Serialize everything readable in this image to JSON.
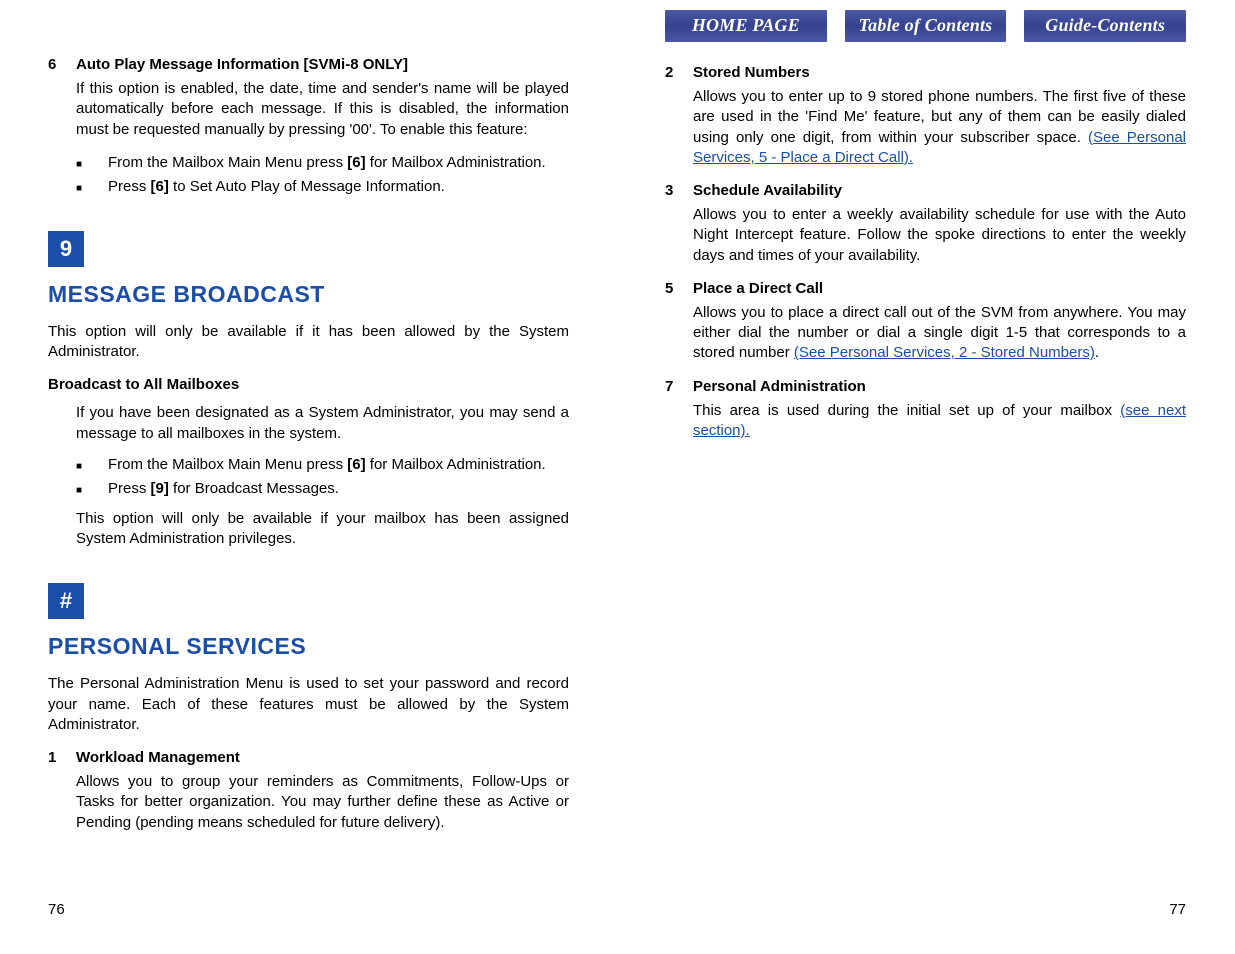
{
  "nav": {
    "home": "HOME PAGE",
    "toc": "Table of Contents",
    "guide": "Guide-Contents"
  },
  "left": {
    "item6": {
      "num": "6",
      "title": "Auto Play Message Information [SVMi-8 ONLY]",
      "body": "If this option is enabled, the date, time and sender's name will be played automatically before each message. If this is disabled, the information must be requested manually by pressing '00'. To enable this feature:",
      "b1_a": "From the Mailbox Main Menu press ",
      "b1_key": "[6]",
      "b1_b": " for Mailbox Administration.",
      "b2_a": "Press ",
      "b2_key": "[6]",
      "b2_b": " to Set Auto Play of Message Information."
    },
    "key9": "9",
    "sec9_title": "MESSAGE BROADCAST",
    "sec9_body": "This option will only be available if it has been allowed by the System Administrator.",
    "broadcast_title": "Broadcast to All Mailboxes",
    "broadcast_body": "If you have been designated as a System Administrator, you may send a message to all mailboxes in the system.",
    "broadcast_b1_a": "From the Mailbox Main Menu press ",
    "broadcast_b1_key": "[6]",
    "broadcast_b1_b": " for Mailbox Administration.",
    "broadcast_b2_a": "Press ",
    "broadcast_b2_key": "[9]",
    "broadcast_b2_b": " for Broadcast Messages.",
    "broadcast_after": "This option will only be available if your mailbox has been assigned System Administration privileges.",
    "keyhash": "#",
    "sec_ps_title": "PERSONAL SERVICES",
    "sec_ps_body": "The Personal Administration Menu is used to set your password and record your name. Each of these features must be allowed by the System Administrator.",
    "item1": {
      "num": "1",
      "title": "Workload Management",
      "body": "Allows you to group your reminders as Commitments, Follow-Ups or Tasks for better organization. You may further define these as Active or Pending (pending means scheduled for future delivery)."
    },
    "pageno": "76"
  },
  "right": {
    "item2": {
      "num": "2",
      "title": "Stored Numbers",
      "body_a": "Allows you to enter up to 9 stored phone numbers. The first five of these are used in the 'Find Me' feature, but any of them can be easily dialed using only one digit, from within your subscriber space. ",
      "link": "(See Personal Services, 5 - Place a Direct Call)."
    },
    "item3": {
      "num": "3",
      "title": "Schedule Availability",
      "body": "Allows you to enter a weekly availability schedule for use with the Auto Night Intercept feature. Follow the spoke directions to enter the weekly days and times of your availability."
    },
    "item5": {
      "num": "5",
      "title": "Place a Direct Call",
      "body_a": "Allows you to place a direct call out of the SVM from anywhere. You may either dial the number or dial a single digit 1-5 that corresponds to a stored number ",
      "link": "(See Personal Services, 2 - Stored Numbers)",
      "body_b": "."
    },
    "item7": {
      "num": "7",
      "title": "Personal Administration",
      "body_a": "This area is used during the initial set up of your mailbox ",
      "link": "(see next section)."
    },
    "pageno": "77"
  }
}
